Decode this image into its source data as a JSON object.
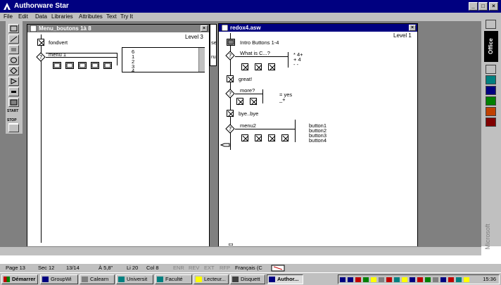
{
  "app": {
    "title": "Authorware Star"
  },
  "menu": [
    "File",
    "Edit",
    "Data",
    "Libraries",
    "Attributes",
    "Text",
    "Try It"
  ],
  "window_left": {
    "title": "Menu_boutons 1à 8",
    "level": "Level 3",
    "icons": [
      {
        "label": "fondvert"
      },
      {
        "label": "menu 1"
      }
    ],
    "panel_values": [
      "6",
      "1",
      "2",
      "3",
      "4"
    ],
    "side_fragments": [
      "se",
      "ru"
    ]
  },
  "window_right": {
    "title": "redox4.asw",
    "level": "Level 1",
    "labels": {
      "intro": "Intro  Buttons 1-4",
      "what": "What is C...?",
      "what_vals": [
        "* 4+",
        "+ 4",
        "- -"
      ],
      "great": "great!",
      "more": "more?",
      "more_vals": [
        "= yes",
        "_+"
      ],
      "bye": "bye..bye",
      "menu2": "menu2",
      "buttons": [
        "button1",
        "button2",
        "button3",
        "button4"
      ]
    }
  },
  "office": {
    "label": "Office"
  },
  "status": {
    "page": "Page 13",
    "sec": "Sec 12",
    "pos": "13/14",
    "at": "À 5,8\"",
    "li": "Li 20",
    "col": "Col 8",
    "e1": "ENR",
    "e2": "REV",
    "e3": "EXT",
    "e4": "RFP",
    "lang": "Français (C"
  },
  "taskbar": {
    "start": "Démarrer",
    "items": [
      "GroupWi",
      "Calearn",
      "Universit",
      "Faculté",
      "Lecteur...",
      "Disquett",
      "Author..."
    ],
    "clock": "15:36"
  },
  "watermark": "Microsoft"
}
